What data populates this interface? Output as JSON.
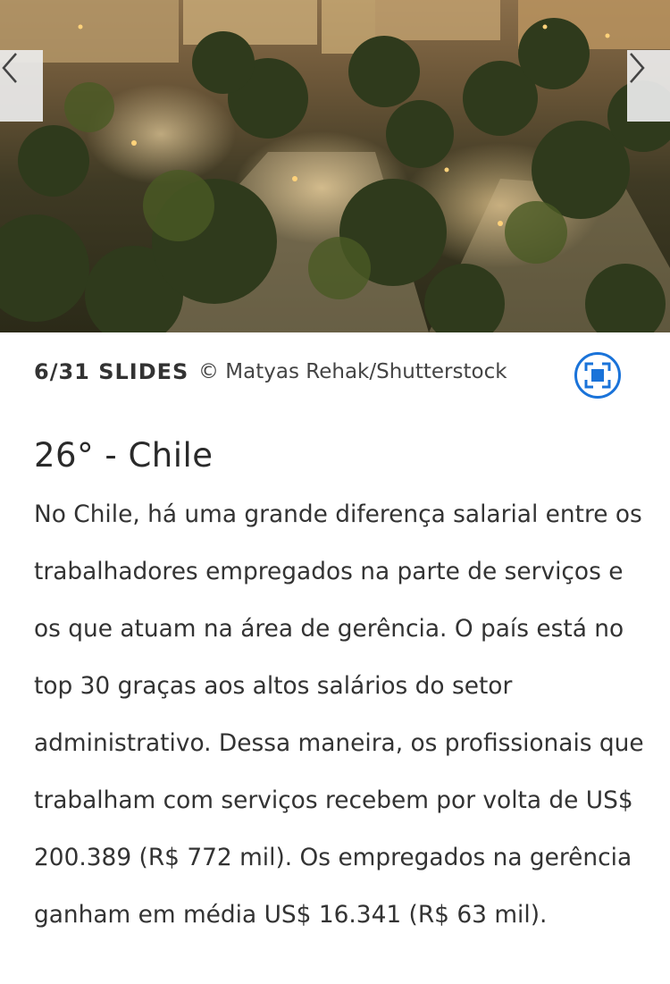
{
  "gallery": {
    "hero_image": {
      "description_icon": "photo-plaza-night",
      "accent_color": "#1a73d9"
    },
    "prev_icon": "chevron-left-icon",
    "next_icon": "chevron-right-icon",
    "slide_counter": "6/31 SLIDES",
    "credit": "© Matyas Rehak/Shutterstock",
    "fullscreen_icon": "fullscreen-icon"
  },
  "article": {
    "title": "26° - Chile",
    "body": "No Chile, há uma grande diferença salarial entre os trabalhadores empregados na parte de serviços e os que atuam na área de gerência. O país está no top 30 graças aos altos salários do setor administrativo. Dessa maneira, os profissionais que trabalham com serviços recebem por volta de US$ 200.389 (R$ 772 mil). Os empregados na gerência ganham em média US$ 16.341 (R$ 63 mil)."
  }
}
